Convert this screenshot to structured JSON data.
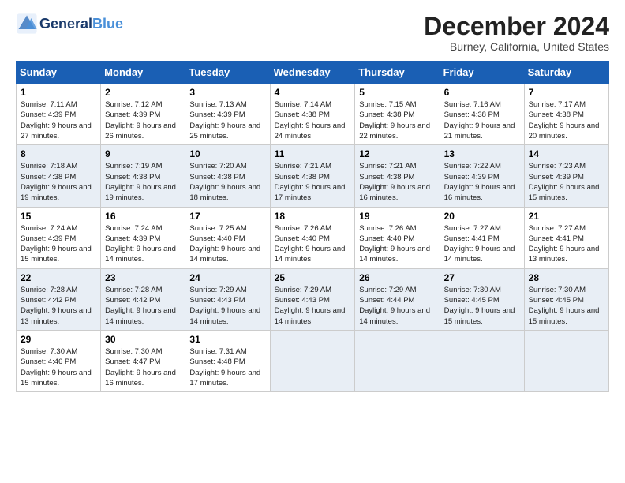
{
  "header": {
    "logo_general": "General",
    "logo_blue": "Blue",
    "month_title": "December 2024",
    "location": "Burney, California, United States"
  },
  "days_of_week": [
    "Sunday",
    "Monday",
    "Tuesday",
    "Wednesday",
    "Thursday",
    "Friday",
    "Saturday"
  ],
  "weeks": [
    [
      {
        "day": "1",
        "sunrise": "7:11 AM",
        "sunset": "4:39 PM",
        "daylight_hours": "9",
        "daylight_minutes": "27"
      },
      {
        "day": "2",
        "sunrise": "7:12 AM",
        "sunset": "4:39 PM",
        "daylight_hours": "9",
        "daylight_minutes": "26"
      },
      {
        "day": "3",
        "sunrise": "7:13 AM",
        "sunset": "4:39 PM",
        "daylight_hours": "9",
        "daylight_minutes": "25"
      },
      {
        "day": "4",
        "sunrise": "7:14 AM",
        "sunset": "4:38 PM",
        "daylight_hours": "9",
        "daylight_minutes": "24"
      },
      {
        "day": "5",
        "sunrise": "7:15 AM",
        "sunset": "4:38 PM",
        "daylight_hours": "9",
        "daylight_minutes": "22"
      },
      {
        "day": "6",
        "sunrise": "7:16 AM",
        "sunset": "4:38 PM",
        "daylight_hours": "9",
        "daylight_minutes": "21"
      },
      {
        "day": "7",
        "sunrise": "7:17 AM",
        "sunset": "4:38 PM",
        "daylight_hours": "9",
        "daylight_minutes": "20"
      }
    ],
    [
      {
        "day": "8",
        "sunrise": "7:18 AM",
        "sunset": "4:38 PM",
        "daylight_hours": "9",
        "daylight_minutes": "19"
      },
      {
        "day": "9",
        "sunrise": "7:19 AM",
        "sunset": "4:38 PM",
        "daylight_hours": "9",
        "daylight_minutes": "19"
      },
      {
        "day": "10",
        "sunrise": "7:20 AM",
        "sunset": "4:38 PM",
        "daylight_hours": "9",
        "daylight_minutes": "18"
      },
      {
        "day": "11",
        "sunrise": "7:21 AM",
        "sunset": "4:38 PM",
        "daylight_hours": "9",
        "daylight_minutes": "17"
      },
      {
        "day": "12",
        "sunrise": "7:21 AM",
        "sunset": "4:38 PM",
        "daylight_hours": "9",
        "daylight_minutes": "16"
      },
      {
        "day": "13",
        "sunrise": "7:22 AM",
        "sunset": "4:39 PM",
        "daylight_hours": "9",
        "daylight_minutes": "16"
      },
      {
        "day": "14",
        "sunrise": "7:23 AM",
        "sunset": "4:39 PM",
        "daylight_hours": "9",
        "daylight_minutes": "15"
      }
    ],
    [
      {
        "day": "15",
        "sunrise": "7:24 AM",
        "sunset": "4:39 PM",
        "daylight_hours": "9",
        "daylight_minutes": "15"
      },
      {
        "day": "16",
        "sunrise": "7:24 AM",
        "sunset": "4:39 PM",
        "daylight_hours": "9",
        "daylight_minutes": "14"
      },
      {
        "day": "17",
        "sunrise": "7:25 AM",
        "sunset": "4:40 PM",
        "daylight_hours": "9",
        "daylight_minutes": "14"
      },
      {
        "day": "18",
        "sunrise": "7:26 AM",
        "sunset": "4:40 PM",
        "daylight_hours": "9",
        "daylight_minutes": "14"
      },
      {
        "day": "19",
        "sunrise": "7:26 AM",
        "sunset": "4:40 PM",
        "daylight_hours": "9",
        "daylight_minutes": "14"
      },
      {
        "day": "20",
        "sunrise": "7:27 AM",
        "sunset": "4:41 PM",
        "daylight_hours": "9",
        "daylight_minutes": "14"
      },
      {
        "day": "21",
        "sunrise": "7:27 AM",
        "sunset": "4:41 PM",
        "daylight_hours": "9",
        "daylight_minutes": "13"
      }
    ],
    [
      {
        "day": "22",
        "sunrise": "7:28 AM",
        "sunset": "4:42 PM",
        "daylight_hours": "9",
        "daylight_minutes": "13"
      },
      {
        "day": "23",
        "sunrise": "7:28 AM",
        "sunset": "4:42 PM",
        "daylight_hours": "9",
        "daylight_minutes": "14"
      },
      {
        "day": "24",
        "sunrise": "7:29 AM",
        "sunset": "4:43 PM",
        "daylight_hours": "9",
        "daylight_minutes": "14"
      },
      {
        "day": "25",
        "sunrise": "7:29 AM",
        "sunset": "4:43 PM",
        "daylight_hours": "9",
        "daylight_minutes": "14"
      },
      {
        "day": "26",
        "sunrise": "7:29 AM",
        "sunset": "4:44 PM",
        "daylight_hours": "9",
        "daylight_minutes": "14"
      },
      {
        "day": "27",
        "sunrise": "7:30 AM",
        "sunset": "4:45 PM",
        "daylight_hours": "9",
        "daylight_minutes": "15"
      },
      {
        "day": "28",
        "sunrise": "7:30 AM",
        "sunset": "4:45 PM",
        "daylight_hours": "9",
        "daylight_minutes": "15"
      }
    ],
    [
      {
        "day": "29",
        "sunrise": "7:30 AM",
        "sunset": "4:46 PM",
        "daylight_hours": "9",
        "daylight_minutes": "15"
      },
      {
        "day": "30",
        "sunrise": "7:30 AM",
        "sunset": "4:47 PM",
        "daylight_hours": "9",
        "daylight_minutes": "16"
      },
      {
        "day": "31",
        "sunrise": "7:31 AM",
        "sunset": "4:48 PM",
        "daylight_hours": "9",
        "daylight_minutes": "17"
      },
      null,
      null,
      null,
      null
    ]
  ],
  "labels": {
    "sunrise": "Sunrise:",
    "sunset": "Sunset:",
    "daylight": "Daylight:"
  }
}
